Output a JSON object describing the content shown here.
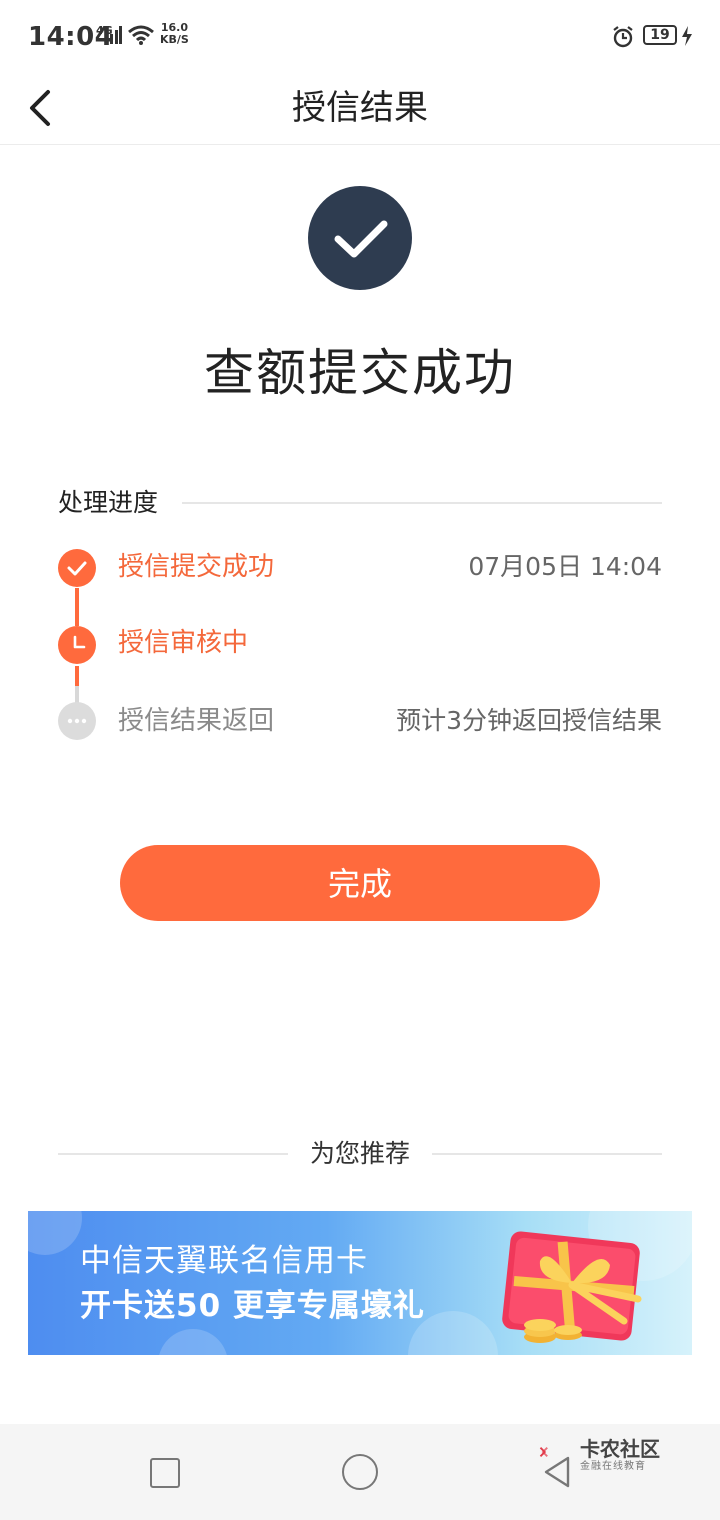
{
  "status_bar": {
    "time": "14:04",
    "network": "4G",
    "speed_value": "16.0",
    "speed_unit": "KB/S",
    "battery": "19"
  },
  "header": {
    "title": "授信结果",
    "back_icon": "chevron-left-icon"
  },
  "result": {
    "icon": "check-icon",
    "title": "查额提交成功",
    "icon_color": "#2e3c50"
  },
  "progress": {
    "label": "处理进度",
    "steps": [
      {
        "label": "授信提交成功",
        "meta": "07月05日 14:04",
        "state": "done",
        "icon": "check-icon"
      },
      {
        "label": "授信审核中",
        "meta": "",
        "state": "active",
        "icon": "clock-icon"
      },
      {
        "label": "授信结果返回",
        "meta": "预计3分钟返回授信结果",
        "state": "pending",
        "icon": "ellipsis-icon"
      }
    ],
    "accent_color": "#ff6a3d"
  },
  "actions": {
    "done_label": "完成"
  },
  "recommend": {
    "title": "为您推荐",
    "banner_line1": "中信天翼联名信用卡",
    "banner_line2": "开卡送50 更享专属壕礼"
  },
  "watermark": {
    "title": "卡农社区",
    "subtitle": "金融在线教育"
  }
}
